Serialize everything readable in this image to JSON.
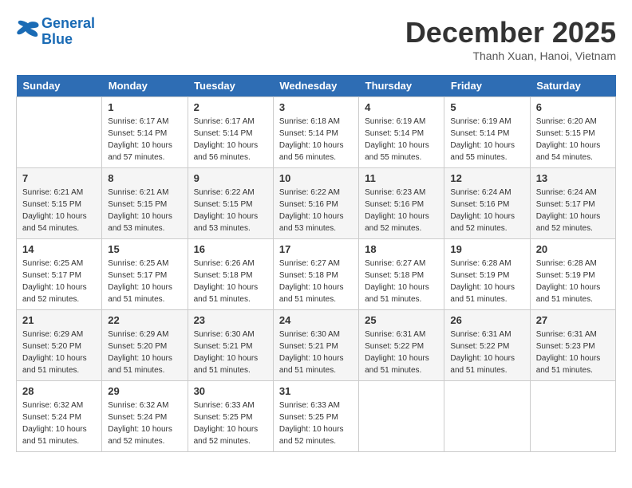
{
  "logo": {
    "line1": "General",
    "line2": "Blue"
  },
  "title": "December 2025",
  "location": "Thanh Xuan, Hanoi, Vietnam",
  "days_of_week": [
    "Sunday",
    "Monday",
    "Tuesday",
    "Wednesday",
    "Thursday",
    "Friday",
    "Saturday"
  ],
  "weeks": [
    [
      {
        "day": "",
        "info": ""
      },
      {
        "day": "1",
        "info": "Sunrise: 6:17 AM\nSunset: 5:14 PM\nDaylight: 10 hours\nand 57 minutes."
      },
      {
        "day": "2",
        "info": "Sunrise: 6:17 AM\nSunset: 5:14 PM\nDaylight: 10 hours\nand 56 minutes."
      },
      {
        "day": "3",
        "info": "Sunrise: 6:18 AM\nSunset: 5:14 PM\nDaylight: 10 hours\nand 56 minutes."
      },
      {
        "day": "4",
        "info": "Sunrise: 6:19 AM\nSunset: 5:14 PM\nDaylight: 10 hours\nand 55 minutes."
      },
      {
        "day": "5",
        "info": "Sunrise: 6:19 AM\nSunset: 5:14 PM\nDaylight: 10 hours\nand 55 minutes."
      },
      {
        "day": "6",
        "info": "Sunrise: 6:20 AM\nSunset: 5:15 PM\nDaylight: 10 hours\nand 54 minutes."
      }
    ],
    [
      {
        "day": "7",
        "info": "Sunrise: 6:21 AM\nSunset: 5:15 PM\nDaylight: 10 hours\nand 54 minutes."
      },
      {
        "day": "8",
        "info": "Sunrise: 6:21 AM\nSunset: 5:15 PM\nDaylight: 10 hours\nand 53 minutes."
      },
      {
        "day": "9",
        "info": "Sunrise: 6:22 AM\nSunset: 5:15 PM\nDaylight: 10 hours\nand 53 minutes."
      },
      {
        "day": "10",
        "info": "Sunrise: 6:22 AM\nSunset: 5:16 PM\nDaylight: 10 hours\nand 53 minutes."
      },
      {
        "day": "11",
        "info": "Sunrise: 6:23 AM\nSunset: 5:16 PM\nDaylight: 10 hours\nand 52 minutes."
      },
      {
        "day": "12",
        "info": "Sunrise: 6:24 AM\nSunset: 5:16 PM\nDaylight: 10 hours\nand 52 minutes."
      },
      {
        "day": "13",
        "info": "Sunrise: 6:24 AM\nSunset: 5:17 PM\nDaylight: 10 hours\nand 52 minutes."
      }
    ],
    [
      {
        "day": "14",
        "info": "Sunrise: 6:25 AM\nSunset: 5:17 PM\nDaylight: 10 hours\nand 52 minutes."
      },
      {
        "day": "15",
        "info": "Sunrise: 6:25 AM\nSunset: 5:17 PM\nDaylight: 10 hours\nand 51 minutes."
      },
      {
        "day": "16",
        "info": "Sunrise: 6:26 AM\nSunset: 5:18 PM\nDaylight: 10 hours\nand 51 minutes."
      },
      {
        "day": "17",
        "info": "Sunrise: 6:27 AM\nSunset: 5:18 PM\nDaylight: 10 hours\nand 51 minutes."
      },
      {
        "day": "18",
        "info": "Sunrise: 6:27 AM\nSunset: 5:18 PM\nDaylight: 10 hours\nand 51 minutes."
      },
      {
        "day": "19",
        "info": "Sunrise: 6:28 AM\nSunset: 5:19 PM\nDaylight: 10 hours\nand 51 minutes."
      },
      {
        "day": "20",
        "info": "Sunrise: 6:28 AM\nSunset: 5:19 PM\nDaylight: 10 hours\nand 51 minutes."
      }
    ],
    [
      {
        "day": "21",
        "info": "Sunrise: 6:29 AM\nSunset: 5:20 PM\nDaylight: 10 hours\nand 51 minutes."
      },
      {
        "day": "22",
        "info": "Sunrise: 6:29 AM\nSunset: 5:20 PM\nDaylight: 10 hours\nand 51 minutes."
      },
      {
        "day": "23",
        "info": "Sunrise: 6:30 AM\nSunset: 5:21 PM\nDaylight: 10 hours\nand 51 minutes."
      },
      {
        "day": "24",
        "info": "Sunrise: 6:30 AM\nSunset: 5:21 PM\nDaylight: 10 hours\nand 51 minutes."
      },
      {
        "day": "25",
        "info": "Sunrise: 6:31 AM\nSunset: 5:22 PM\nDaylight: 10 hours\nand 51 minutes."
      },
      {
        "day": "26",
        "info": "Sunrise: 6:31 AM\nSunset: 5:22 PM\nDaylight: 10 hours\nand 51 minutes."
      },
      {
        "day": "27",
        "info": "Sunrise: 6:31 AM\nSunset: 5:23 PM\nDaylight: 10 hours\nand 51 minutes."
      }
    ],
    [
      {
        "day": "28",
        "info": "Sunrise: 6:32 AM\nSunset: 5:24 PM\nDaylight: 10 hours\nand 51 minutes."
      },
      {
        "day": "29",
        "info": "Sunrise: 6:32 AM\nSunset: 5:24 PM\nDaylight: 10 hours\nand 52 minutes."
      },
      {
        "day": "30",
        "info": "Sunrise: 6:33 AM\nSunset: 5:25 PM\nDaylight: 10 hours\nand 52 minutes."
      },
      {
        "day": "31",
        "info": "Sunrise: 6:33 AM\nSunset: 5:25 PM\nDaylight: 10 hours\nand 52 minutes."
      },
      {
        "day": "",
        "info": ""
      },
      {
        "day": "",
        "info": ""
      },
      {
        "day": "",
        "info": ""
      }
    ]
  ]
}
